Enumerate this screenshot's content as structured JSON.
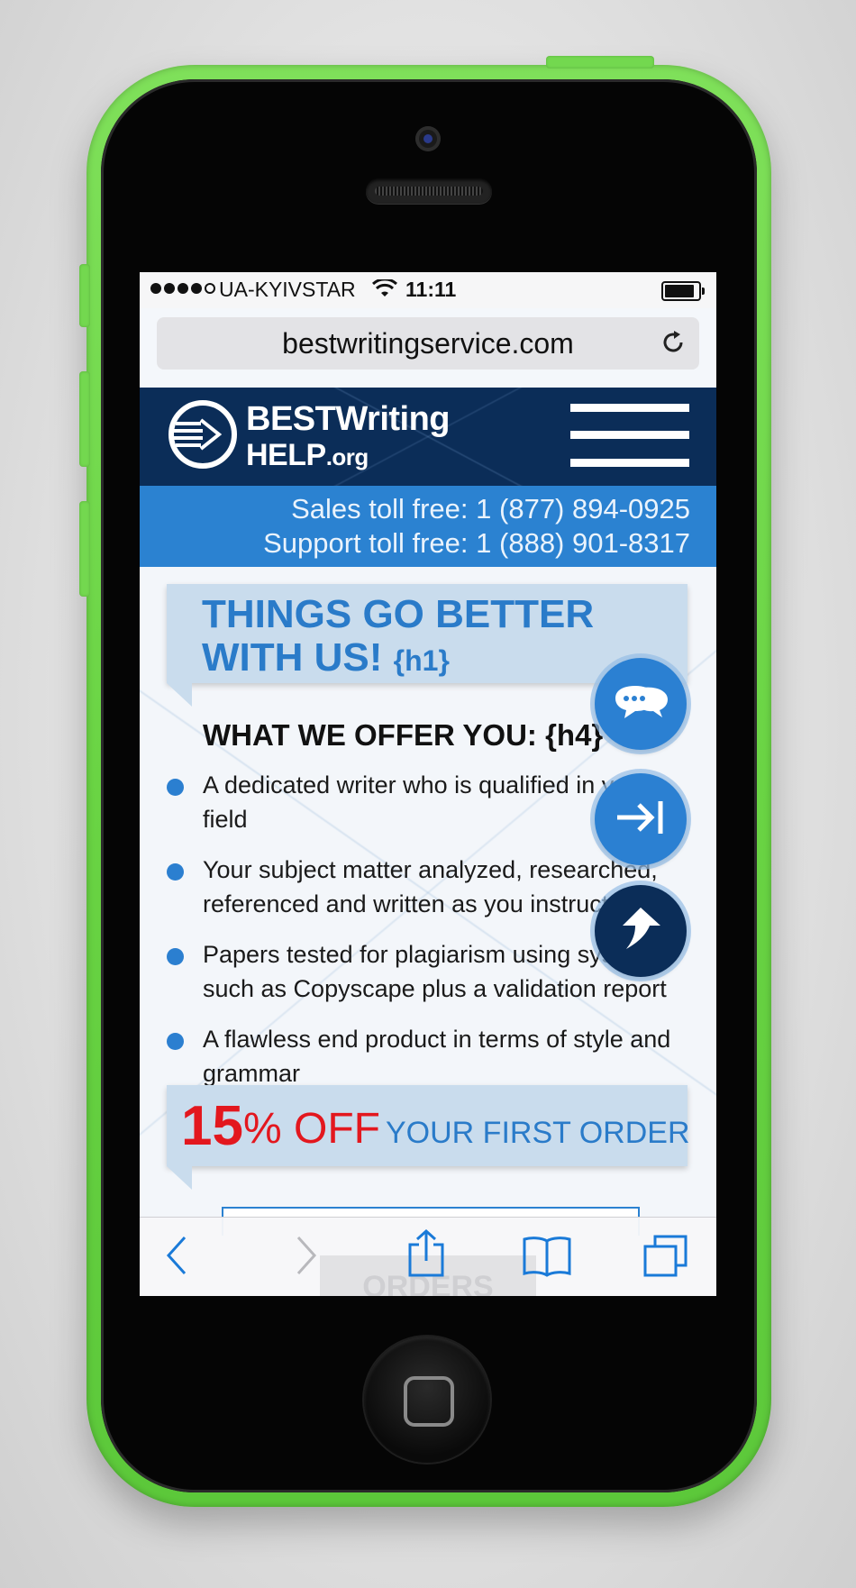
{
  "status_bar": {
    "carrier": "UA-KYIVSTAR",
    "time": "11:11",
    "signal_bars": 4,
    "signal_max": 5
  },
  "browser": {
    "url": "bestwritingservice.com"
  },
  "site_header": {
    "logo_line1": "BESTWriting",
    "logo_line2_main": "HELP",
    "logo_line2_suffix": ".org"
  },
  "contact": {
    "sales_label": "Sales toll free:",
    "sales_phone": "1 (877) 894-0925",
    "support_label": "Support toll free:",
    "support_phone": "1 (888) 901-8317"
  },
  "hero": {
    "line1": "THINGS GO BETTER",
    "line2": "WITH US!",
    "tag": "{h1}"
  },
  "offer": {
    "heading": "WHAT WE OFFER YOU: {h4}",
    "items": [
      "A dedicated writer who is qualified in your field",
      "Your subject matter analyzed, researched, referenced and written as you instruct",
      "Papers tested for plagiarism using systems such as Copyscape plus a validation report",
      "A flawless end product in terms of style and grammar"
    ]
  },
  "promo": {
    "number": "15",
    "percent_off": "% OFF",
    "rest": "YOUR FIRST ORDER"
  },
  "toolbar": {
    "peek_label": "ORDERS"
  },
  "colors": {
    "phone_body": "#6ad444",
    "header_navy": "#0b2d58",
    "accent_blue": "#2b82d1",
    "promo_red": "#e3171e",
    "ios_blue": "#1a7ad8"
  }
}
